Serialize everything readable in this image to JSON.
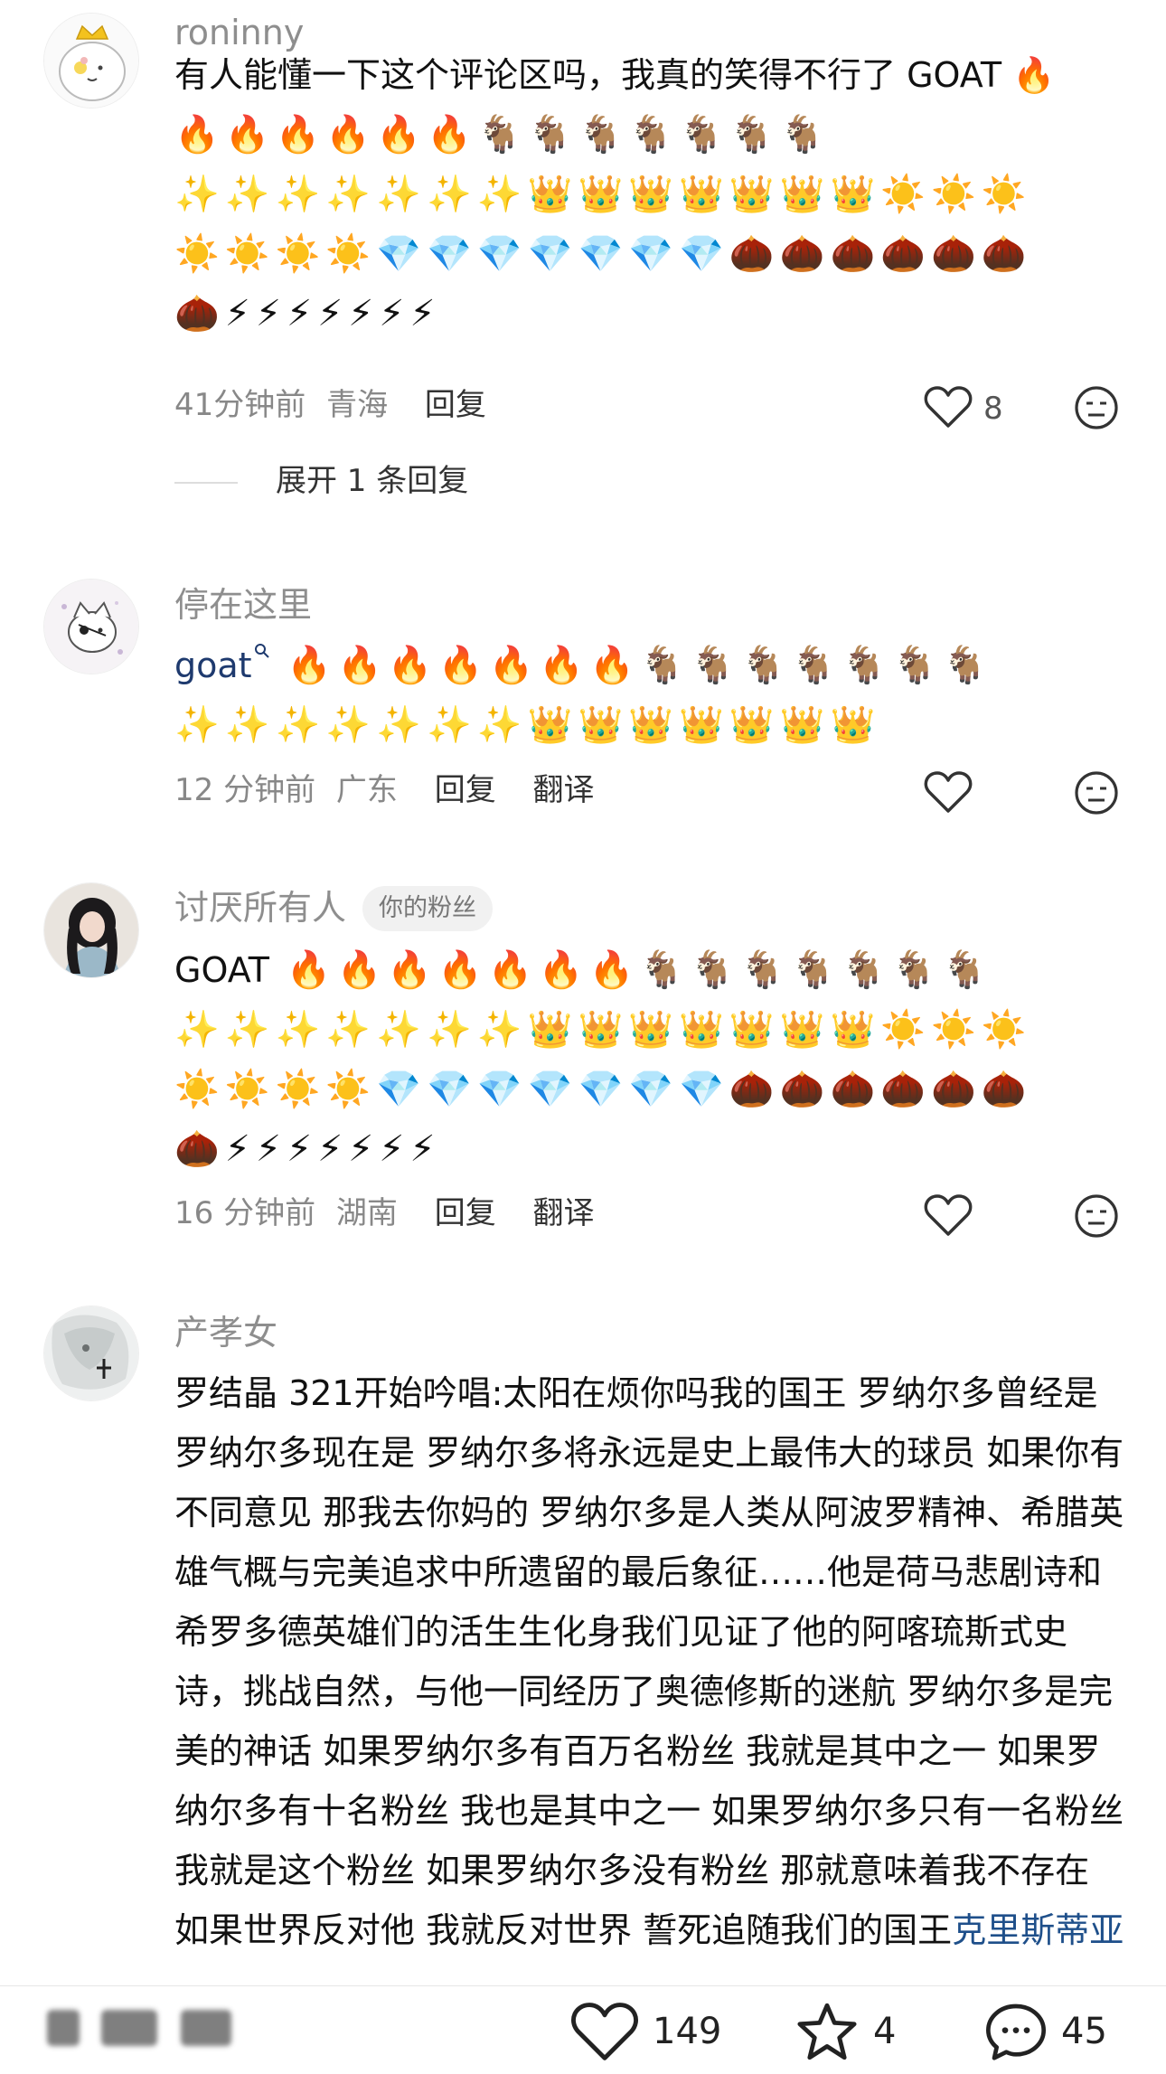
{
  "comments": [
    {
      "username": "roninny",
      "text_line1": "有人能懂一下这个评论区吗，我真的笑得不行了 GOAT 🔥",
      "emoji_rows": [
        "🔥🔥🔥🔥🔥🔥🐐🐐🐐🐐🐐🐐🐐",
        "✨✨✨✨✨✨✨👑👑👑👑👑👑👑☀️☀️☀️",
        "☀️☀️☀️☀️💎💎💎💎💎💎💎🌰🌰🌰🌰🌰🌰",
        "🌰⚡⚡⚡⚡⚡⚡⚡"
      ],
      "time": "41分钟前",
      "location": "青海",
      "reply_label": "回复",
      "like_count": "8",
      "expand_label": "展开 1 条回复"
    },
    {
      "username": "停在这里",
      "text_prefix": "goat",
      "emoji_rows": [
        "🔥🔥🔥🔥🔥🔥🔥🐐🐐🐐🐐🐐🐐🐐",
        "✨✨✨✨✨✨✨👑👑👑👑👑👑👑"
      ],
      "time": "12 分钟前",
      "location": "广东",
      "reply_label": "回复",
      "translate_label": "翻译"
    },
    {
      "username": "讨厌所有人",
      "badge": "你的粉丝",
      "text_prefix": "GOAT",
      "emoji_rows": [
        "🔥🔥🔥🔥🔥🔥🔥🐐🐐🐐🐐🐐🐐🐐",
        "✨✨✨✨✨✨✨👑👑👑👑👑👑👑☀️☀️☀️",
        "☀️☀️☀️☀️💎💎💎💎💎💎💎🌰🌰🌰🌰🌰🌰",
        "🌰⚡⚡⚡⚡⚡⚡⚡"
      ],
      "time": "16 分钟前",
      "location": "湖南",
      "reply_label": "回复",
      "translate_label": "翻译"
    },
    {
      "username": "产孝女",
      "text": "罗结晶 321开始吟唱:太阳在烦你吗我的国王 罗纳尔多曾经是 罗纳尔多现在是 罗纳尔多将永远是史上最伟大的球员 如果你有不同意见 那我去你妈的 罗纳尔多是人类从阿波罗精神、希腊英雄气概与完美追求中所遗留的最后象征……他是荷马悲剧诗和希罗多德英雄们的活生生化身我们见证了他的阿喀琉斯式史诗，挑战自然，与他一同经历了奥德修斯的迷航 罗纳尔多是完美的神话 如果罗纳尔多有百万名粉丝 我就是其中之一 如果罗纳尔多有十名粉丝 我也是其中之一 如果罗纳尔多只有一名粉丝 我就是这个粉丝 如果罗纳尔多没有粉丝 那就意味着我不存在 如果世",
      "cut_line": "界反对他 我就反对世界 誓死追随我们的国王",
      "cut_link": "克里斯蒂亚"
    }
  ],
  "bottom_bar": {
    "likes": "149",
    "favorites": "4",
    "comments": "45"
  }
}
